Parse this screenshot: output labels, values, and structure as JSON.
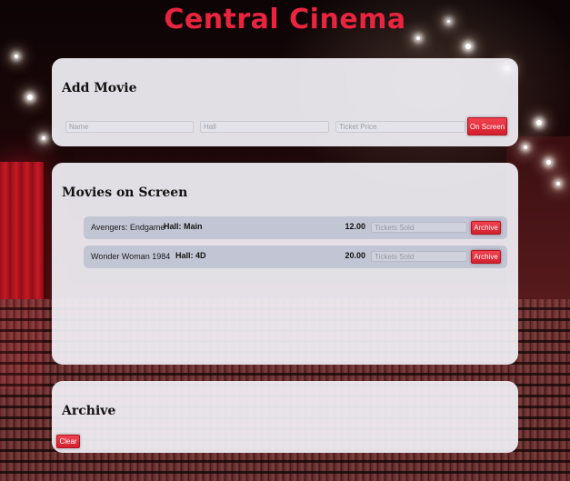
{
  "page": {
    "title": "Central Cinema"
  },
  "add_movie": {
    "heading": "Add Movie",
    "name_placeholder": "Name",
    "name_value": "",
    "hall_placeholder": "Hall",
    "hall_value": "",
    "price_placeholder": "Ticket Price",
    "price_value": "",
    "submit_label": "On Screen"
  },
  "on_screen": {
    "heading": "Movies on Screen",
    "movies": [
      {
        "name": "Avengers: Endgame",
        "hall": "Hall: Main",
        "price": "12.00",
        "sold_placeholder": "Tickets Sold",
        "archive_label": "Archive"
      },
      {
        "name": "Wonder Woman 1984",
        "hall": "Hall: 4D",
        "price": "20.00",
        "sold_placeholder": "Tickets Sold",
        "archive_label": "Archive"
      }
    ]
  },
  "archive": {
    "heading": "Archive",
    "clear_label": "Clear"
  },
  "colors": {
    "title_red": "#e8243e",
    "button_red": "#e0303e",
    "panel_bg": "#f3f2f7",
    "movie_row_bg": "#c2c5d4"
  }
}
